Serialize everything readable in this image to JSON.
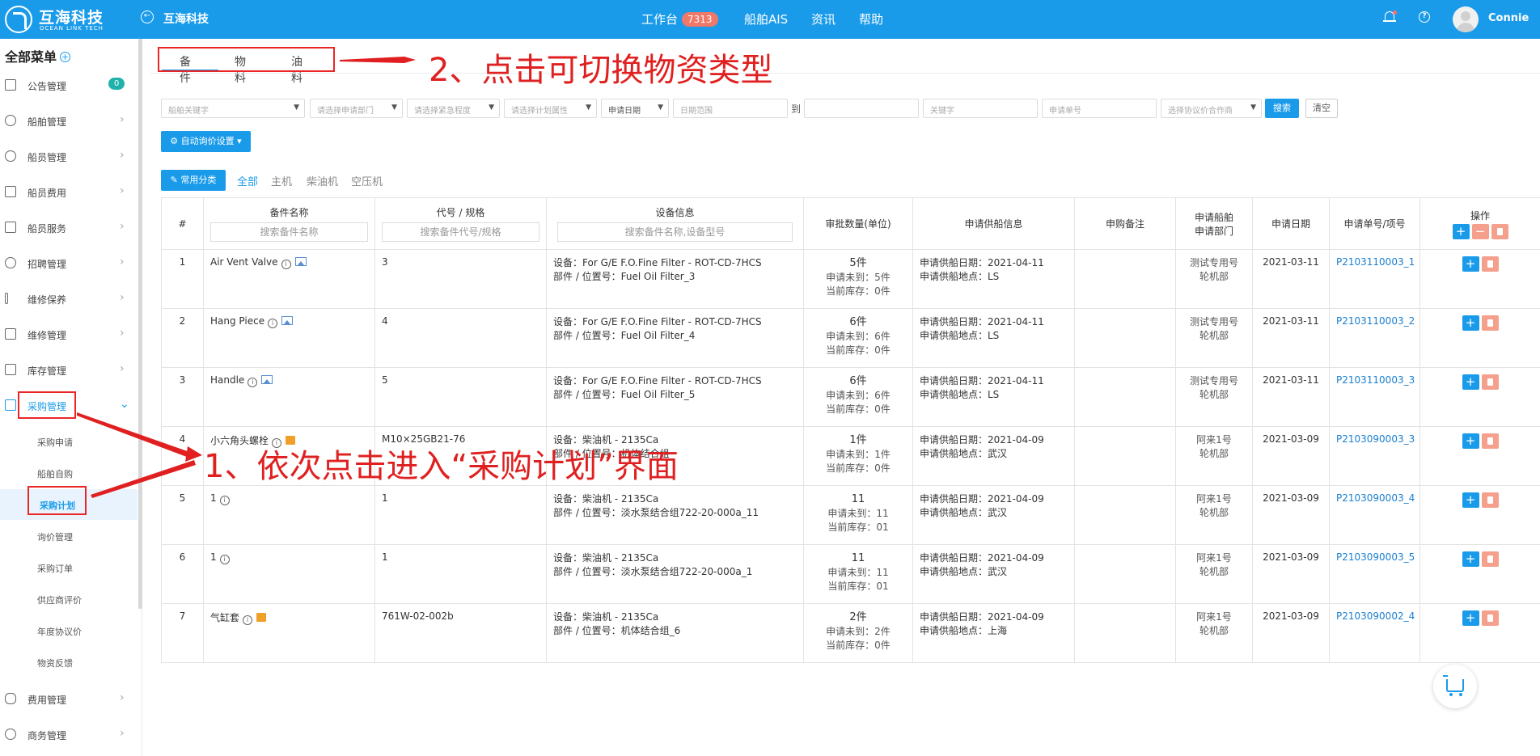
{
  "header": {
    "logo_cn": "互海科技",
    "logo_en": "OCEAN LINK TECH",
    "back_label": "互海科技",
    "nav": [
      {
        "label": "工作台",
        "badge": "7313"
      },
      {
        "label": "船舶AIS"
      },
      {
        "label": "资讯"
      },
      {
        "label": "帮助"
      }
    ],
    "user": "Connie"
  },
  "sidebar": {
    "title": "全部菜单",
    "items": [
      {
        "label": "公告管理",
        "icon": "book-icon",
        "badge": "0"
      },
      {
        "label": "船舶管理",
        "icon": "anchor-icon"
      },
      {
        "label": "船员管理",
        "icon": "user-icon"
      },
      {
        "label": "船员费用",
        "icon": "wallet-icon"
      },
      {
        "label": "船员服务",
        "icon": "monitor-icon"
      },
      {
        "label": "招聘管理",
        "icon": "user-add-icon"
      },
      {
        "label": "维修保养",
        "icon": "tool-icon"
      },
      {
        "label": "维修管理",
        "icon": "wrench-icon"
      },
      {
        "label": "库存管理",
        "icon": "home-icon"
      },
      {
        "label": "采购管理",
        "icon": "cart-icon"
      },
      {
        "label": "费用管理",
        "icon": "database-icon"
      },
      {
        "label": "商务管理",
        "icon": "globe-icon"
      }
    ],
    "sub_items": [
      "采购申请",
      "船舶自购",
      "采购计划",
      "询价管理",
      "采购订单",
      "供应商评价",
      "年度协议价",
      "物资反馈"
    ]
  },
  "type_tabs": [
    "备件",
    "物料",
    "油料"
  ],
  "annotations": {
    "a1": "1、依次点击进入“采购计划”界面",
    "a2": "2、点击可切换物资类型"
  },
  "filters": {
    "ship_keyword": "船舶关键字",
    "dept": "请选择申请部门",
    "urgency": "请选择紧急程度",
    "plan_attr": "请选择计划属性",
    "date_type": "申请日期",
    "date_range": "日期范围",
    "to": "到",
    "keyword": "关键字",
    "order_no": "申请单号",
    "agreement": "选择协议价合作商",
    "search": "搜索",
    "clear": "清空",
    "auto_inquiry": "自动询价设置"
  },
  "categories": {
    "button": "常用分类",
    "items": [
      "全部",
      "主机",
      "柴油机",
      "空压机"
    ]
  },
  "table": {
    "headers": {
      "no": "#",
      "name": "备件名称",
      "name_ph": "搜索备件名称",
      "code": "代号 / 规格",
      "code_ph": "搜索备件代号/规格",
      "equip": "设备信息",
      "equip_ph": "搜索备件名称,设备型号",
      "qty": "审批数量(单位)",
      "supply": "申请供船信息",
      "remark": "申购备注",
      "ship": "申请船舶",
      "dept": "申请部门",
      "date": "申请日期",
      "order": "申请单号/项号",
      "ops": "操作"
    },
    "rows": [
      {
        "no": "1",
        "name": "Air Vent Valve",
        "code": "3",
        "equip": "设备：For G/E F.O.Fine Filter - ROT-CD-7HCS",
        "part": "部件 / 位置号：Fuel Oil Filter_3",
        "qty": "5件",
        "req": "申请未到：5件",
        "stock": "当前库存：0件",
        "sdate": "申请供船日期：2021-04-11",
        "splace": "申请供船地点：LS",
        "ship": "测试专用号",
        "dept": "轮机部",
        "date": "2021-03-11",
        "order": "P2103110003_1",
        "icons": [
          "info-icon",
          "image-icon"
        ]
      },
      {
        "no": "2",
        "name": "Hang Piece",
        "code": "4",
        "equip": "设备：For G/E F.O.Fine Filter - ROT-CD-7HCS",
        "part": "部件 / 位置号：Fuel Oil Filter_4",
        "qty": "6件",
        "req": "申请未到：6件",
        "stock": "当前库存：0件",
        "sdate": "申请供船日期：2021-04-11",
        "splace": "申请供船地点：LS",
        "ship": "测试专用号",
        "dept": "轮机部",
        "date": "2021-03-11",
        "order": "P2103110003_2",
        "icons": [
          "info-icon",
          "image-icon"
        ]
      },
      {
        "no": "3",
        "name": "Handle",
        "code": "5",
        "equip": "设备：For G/E F.O.Fine Filter - ROT-CD-7HCS",
        "part": "部件 / 位置号：Fuel Oil Filter_5",
        "qty": "6件",
        "req": "申请未到：6件",
        "stock": "当前库存：0件",
        "sdate": "申请供船日期：2021-04-11",
        "splace": "申请供船地点：LS",
        "ship": "测试专用号",
        "dept": "轮机部",
        "date": "2021-03-11",
        "order": "P2103110003_3",
        "icons": [
          "info-icon",
          "image-icon"
        ]
      },
      {
        "no": "4",
        "name": "小六角头螺栓",
        "code": "M10×25GB21-76",
        "equip": "设备：柴油机 - 2135Ca",
        "part": "部件 / 位置号：机体结合组",
        "qty": "1件",
        "req": "申请未到：1件",
        "stock": "当前库存：0件",
        "sdate": "申请供船日期：2021-04-09",
        "splace": "申请供船地点：武汉",
        "ship": "阿来1号",
        "dept": "轮机部",
        "date": "2021-03-09",
        "order": "P2103090003_3",
        "icons": [
          "info-icon",
          "flag-icon"
        ]
      },
      {
        "no": "5",
        "name": "1",
        "code": "1",
        "equip": "设备：柴油机 - 2135Ca",
        "part": "部件 / 位置号：淡水泵结合组722-20-000a_11",
        "qty": "11",
        "req": "申请未到：11",
        "stock": "当前库存：01",
        "sdate": "申请供船日期：2021-04-09",
        "splace": "申请供船地点：武汉",
        "ship": "阿来1号",
        "dept": "轮机部",
        "date": "2021-03-09",
        "order": "P2103090003_4",
        "icons": [
          "info-icon"
        ]
      },
      {
        "no": "6",
        "name": "1",
        "code": "1",
        "equip": "设备：柴油机 - 2135Ca",
        "part": "部件 / 位置号：淡水泵结合组722-20-000a_1",
        "qty": "11",
        "req": "申请未到：11",
        "stock": "当前库存：01",
        "sdate": "申请供船日期：2021-04-09",
        "splace": "申请供船地点：武汉",
        "ship": "阿来1号",
        "dept": "轮机部",
        "date": "2021-03-09",
        "order": "P2103090003_5",
        "icons": [
          "info-icon"
        ]
      },
      {
        "no": "7",
        "name": "气缸套",
        "code": "761W-02-002b",
        "equip": "设备：柴油机 - 2135Ca",
        "part": "部件 / 位置号：机体结合组_6",
        "qty": "2件",
        "req": "申请未到：2件",
        "stock": "当前库存：0件",
        "sdate": "申请供船日期：2021-04-09",
        "splace": "申请供船地点：上海",
        "ship": "阿来1号",
        "dept": "轮机部",
        "date": "2021-03-09",
        "order": "P2103090002_4",
        "icons": [
          "info-icon",
          "flag-icon"
        ]
      }
    ]
  },
  "colors": {
    "primary": "#1a9bea",
    "annotation": "#e02020",
    "danger_light": "#f4a08d"
  }
}
